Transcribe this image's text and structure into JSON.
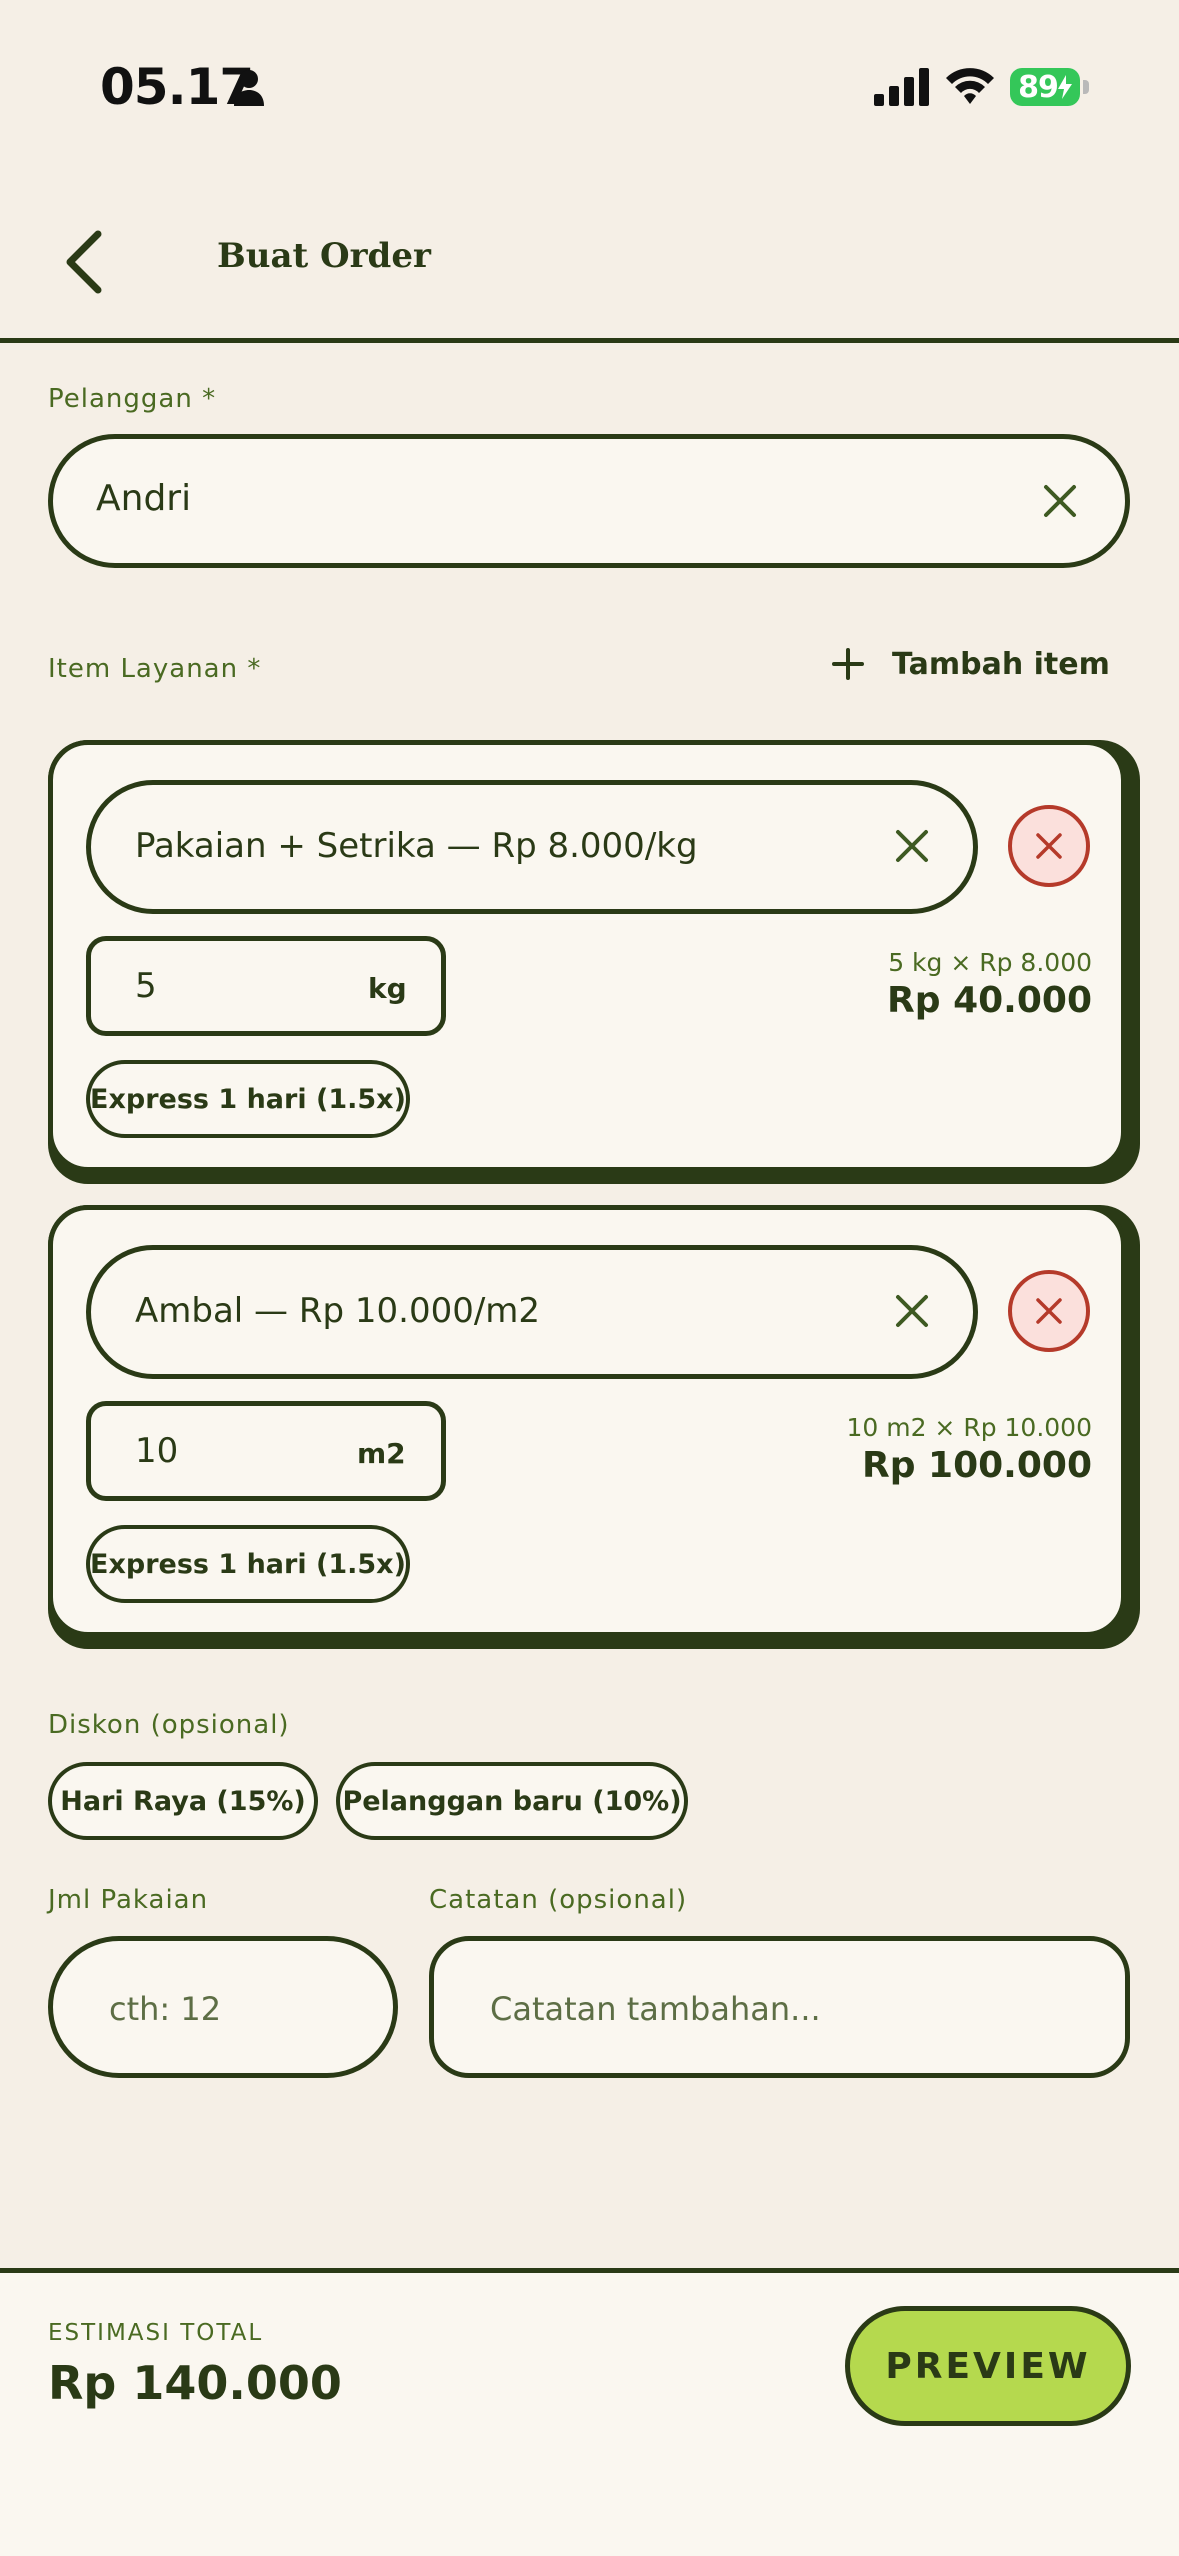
{
  "status_bar": {
    "time": "05.17",
    "battery": "89"
  },
  "header": {
    "title": "Buat Order"
  },
  "customer": {
    "label": "Pelanggan *",
    "value": "Andri"
  },
  "items_section": {
    "label": "Item Layanan *",
    "add_label": "Tambah item"
  },
  "items": [
    {
      "service": "Pakaian + Setrika  —  Rp 8.000/kg",
      "qty": "5",
      "unit": "kg",
      "calc": "5 kg × Rp 8.000",
      "subtotal": "Rp 40.000",
      "option": "Express 1 hari (1.5x)"
    },
    {
      "service": "Ambal  —  Rp 10.000/m2",
      "qty": "10",
      "unit": "m2",
      "calc": "10 m2 × Rp 10.000",
      "subtotal": "Rp 100.000",
      "option": "Express 1 hari (1.5x)"
    }
  ],
  "discount": {
    "label": "Diskon (opsional)",
    "options": [
      "Hari Raya (15%)",
      "Pelanggan baru (10%)"
    ]
  },
  "garments": {
    "label": "Jml Pakaian",
    "placeholder": "cth: 12"
  },
  "notes": {
    "label": "Catatan (opsional)",
    "placeholder": "Catatan tambahan..."
  },
  "footer": {
    "total_label": "ESTIMASI TOTAL",
    "total_value": "Rp 140.000",
    "preview_label": "PREVIEW"
  },
  "colors": {
    "background": "#f5efe6",
    "primary": "#2a3a16",
    "accent": "#b5d94e",
    "danger": "#b53a2a",
    "battery": "#34c759"
  }
}
